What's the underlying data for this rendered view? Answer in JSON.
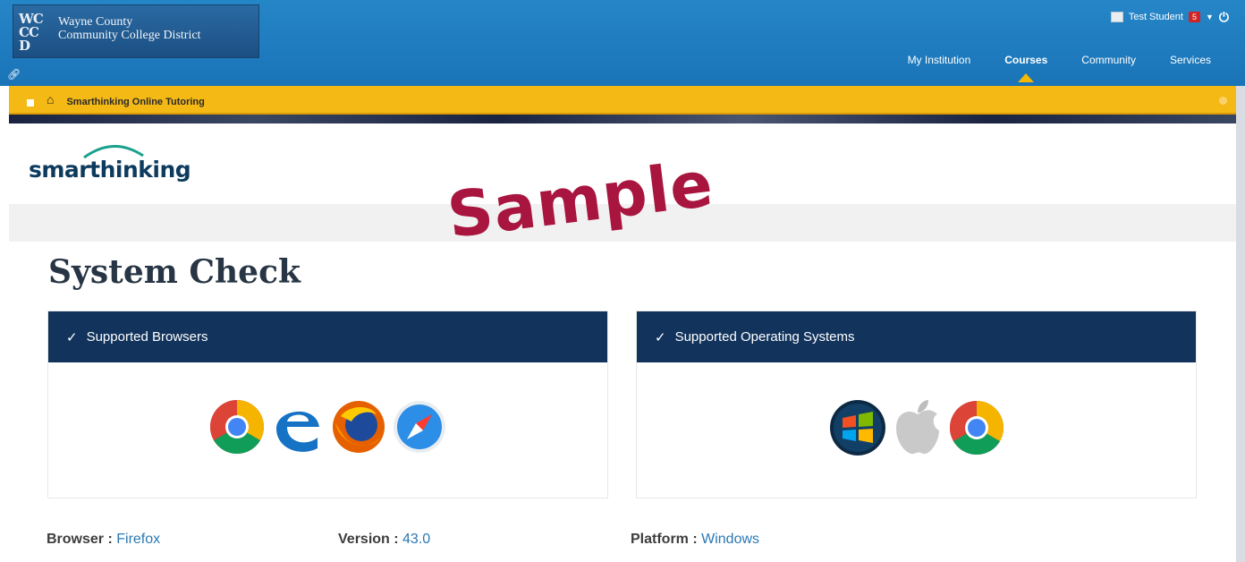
{
  "header": {
    "logo_mark": [
      "WC",
      "CC",
      "D"
    ],
    "logo_line1": "Wayne County",
    "logo_line2": "Community College District",
    "user_name": "Test Student",
    "notification_count": "5",
    "nav": [
      "My Institution",
      "Courses",
      "Community",
      "Services"
    ],
    "active_nav": "Courses"
  },
  "breadcrumb": {
    "title": "Smarthinking Online Tutoring"
  },
  "brand": {
    "name": "smarthinking"
  },
  "watermark": "Sample",
  "page": {
    "title": "System Check",
    "browsers_panel": {
      "heading": "Supported Browsers",
      "icons": [
        "chrome-icon",
        "edge-icon",
        "firefox-icon",
        "safari-icon"
      ]
    },
    "os_panel": {
      "heading": "Supported Operating Systems",
      "icons": [
        "windows-icon",
        "apple-icon",
        "chrome-os-icon"
      ]
    }
  },
  "info": {
    "browser_label": "Browser :",
    "browser_value": "Firefox",
    "version_label": "Version :",
    "version_value": "43.0",
    "platform_label": "Platform :",
    "platform_value": "Windows"
  },
  "colors": {
    "header_blue": "#1f7dbf",
    "breadcrumb_yellow": "#f5b915",
    "panel_navy": "#12345c",
    "watermark": "#a8153f",
    "link_blue": "#2a78b4"
  }
}
